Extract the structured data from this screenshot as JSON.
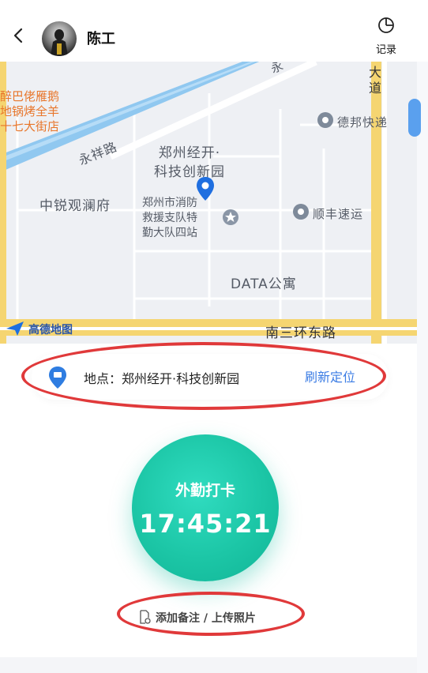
{
  "header": {
    "user_name": "陈工",
    "record_label": "记录"
  },
  "map": {
    "labels": {
      "road_yongxiang": "永祥路",
      "poi_zhengzhou_jingkai": "郑州经开·",
      "poi_keji": "科技创新园",
      "poi_zhongrui": "中锐观澜府",
      "poi_fire1": "郑州市消防",
      "poi_fire2": "救援支队特",
      "poi_fire3": "勤大队四站",
      "poi_debang": "德邦快递",
      "poi_shunfeng": "顺丰速运",
      "poi_data": "DATA公寓",
      "road_nansanhuan": "南三环东路",
      "restaurant1": "醉巴佬雁鹅",
      "restaurant2": "地锅烤全羊",
      "restaurant3": "十七大街店",
      "road_right1": "大",
      "road_right2": "道",
      "road_top": "永",
      "brand": "高德地图"
    }
  },
  "location": {
    "text": "地点：郑州经开·科技创新园",
    "refresh_label": "刷新定位"
  },
  "clock": {
    "label": "外勤打卡",
    "time": "17:45:21"
  },
  "note": {
    "label": "添加备注 / 上传照片"
  },
  "colors": {
    "accent_teal": "#1cc6a6",
    "link_blue": "#3b7ce4",
    "annotation_red": "#e0393a",
    "road_yellow": "#f5d571",
    "river_blue": "#90c8f0"
  }
}
